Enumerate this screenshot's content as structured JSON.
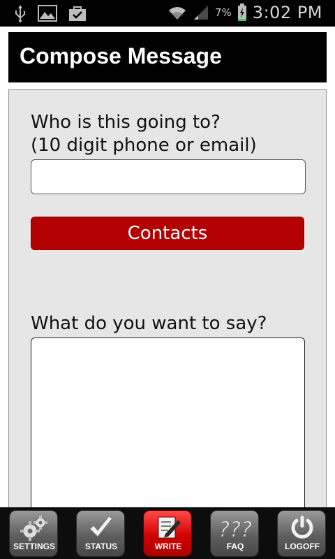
{
  "status_bar": {
    "battery_percent": "7%",
    "time": "3:02 PM",
    "icons": [
      "usb-icon",
      "image-icon",
      "shopping-bag-icon",
      "wifi-icon",
      "signal-icon",
      "battery-icon"
    ]
  },
  "header": {
    "title": "Compose Message"
  },
  "form": {
    "recipient_label": "Who is this going to?",
    "recipient_hint": "(10 digit phone or email)",
    "recipient_value": "",
    "contacts_label": "Contacts",
    "message_label": "What do you want to say?",
    "message_value": ""
  },
  "nav": {
    "items": [
      {
        "label": "SETTINGS",
        "icon": "gears-icon"
      },
      {
        "label": "STATUS",
        "icon": "checkmark-icon"
      },
      {
        "label": "WRITE",
        "icon": "pencil-note-icon",
        "active": true
      },
      {
        "label": "FAQ",
        "icon": "question-marks-icon"
      },
      {
        "label": "LOGOFF",
        "icon": "power-icon"
      }
    ]
  },
  "colors": {
    "header_bg": "#000000",
    "panel_bg": "#e6e6e6",
    "accent_red": "#b30000",
    "active_nav_red": "#d20000"
  }
}
